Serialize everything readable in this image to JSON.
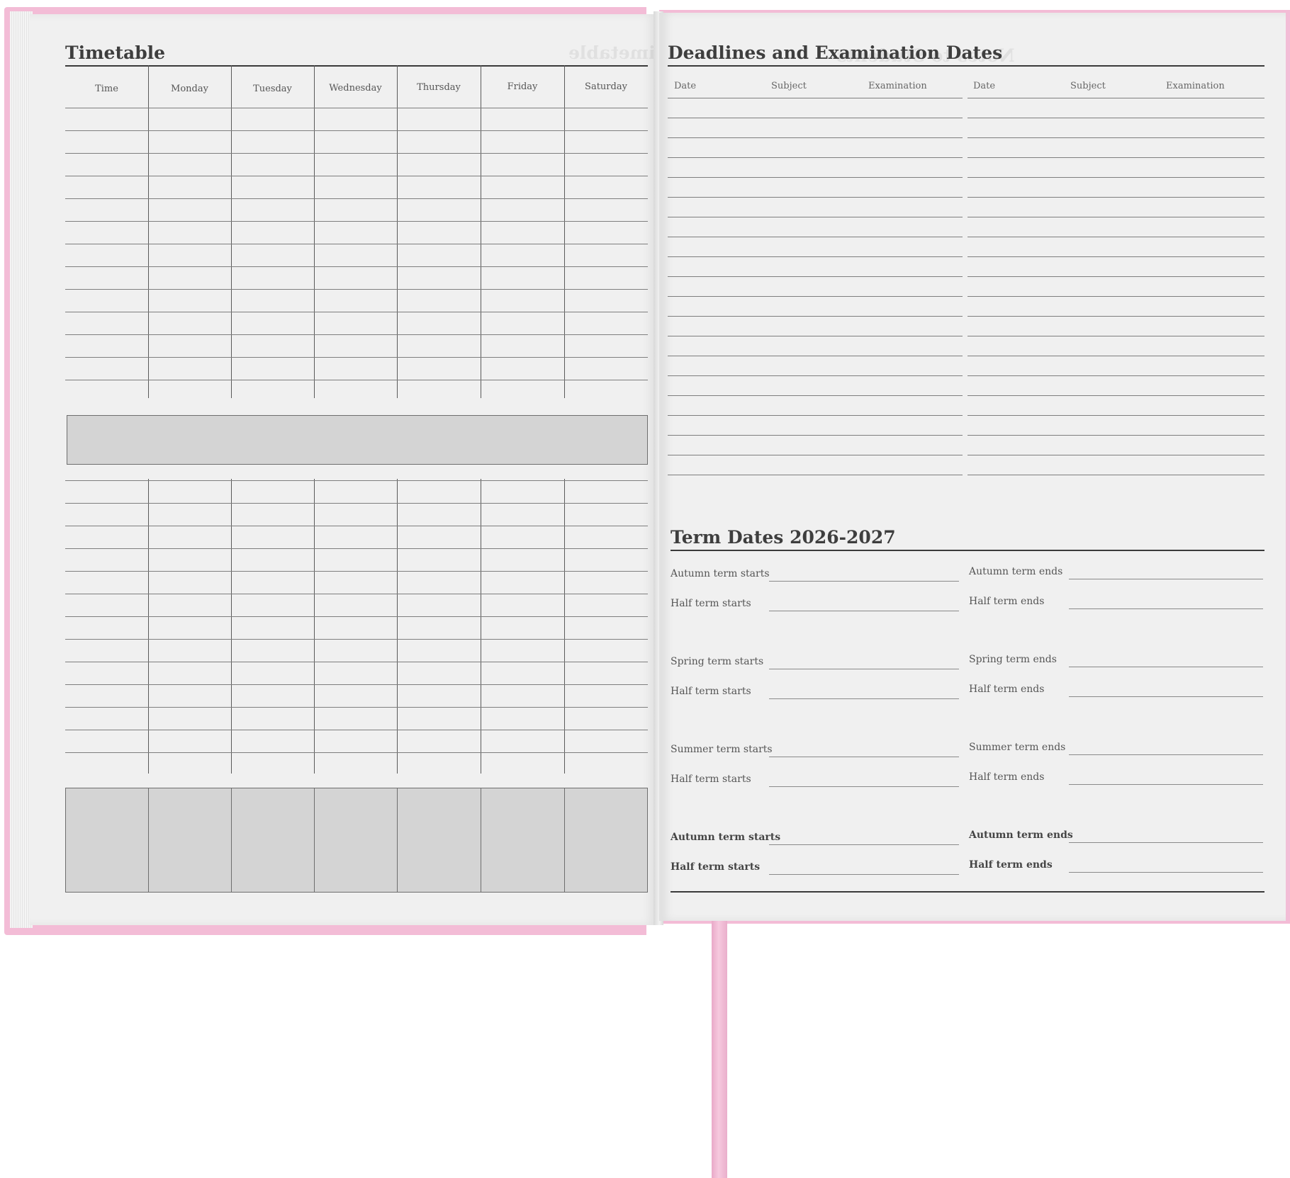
{
  "colors": {
    "cover": "#f3bcd6",
    "paper": "#f0f0f0",
    "shade": "#d4d4d4",
    "ink": "#3e3e3e"
  },
  "left_page": {
    "title": "Timetable",
    "mirror_title": "Timetable",
    "columns": [
      "Time",
      "Monday",
      "Tuesday",
      "Wednesday",
      "Thursday",
      "Friday",
      "Saturday"
    ]
  },
  "right_page": {
    "deadlines": {
      "title": "Deadlines and Examination Dates",
      "mirror_title": "Notes to Students",
      "columns": [
        "Date",
        "Subject",
        "Examination",
        "Date",
        "Subject",
        "Examination"
      ]
    },
    "term_dates": {
      "title": "Term Dates 2026-2027",
      "groups": [
        {
          "left": [
            "Autumn term starts",
            "Half term starts"
          ],
          "right": [
            "Autumn term ends",
            "Half term ends"
          ]
        },
        {
          "left": [
            "Spring term starts",
            "Half term starts"
          ],
          "right": [
            "Spring term ends",
            "Half term ends"
          ]
        },
        {
          "left": [
            "Summer term starts",
            "Half term starts"
          ],
          "right": [
            "Summer term ends",
            "Half term ends"
          ]
        },
        {
          "left": [
            "Autumn term starts",
            "Half term starts"
          ],
          "right": [
            "Autumn term ends",
            "Half term ends"
          ]
        }
      ]
    }
  }
}
